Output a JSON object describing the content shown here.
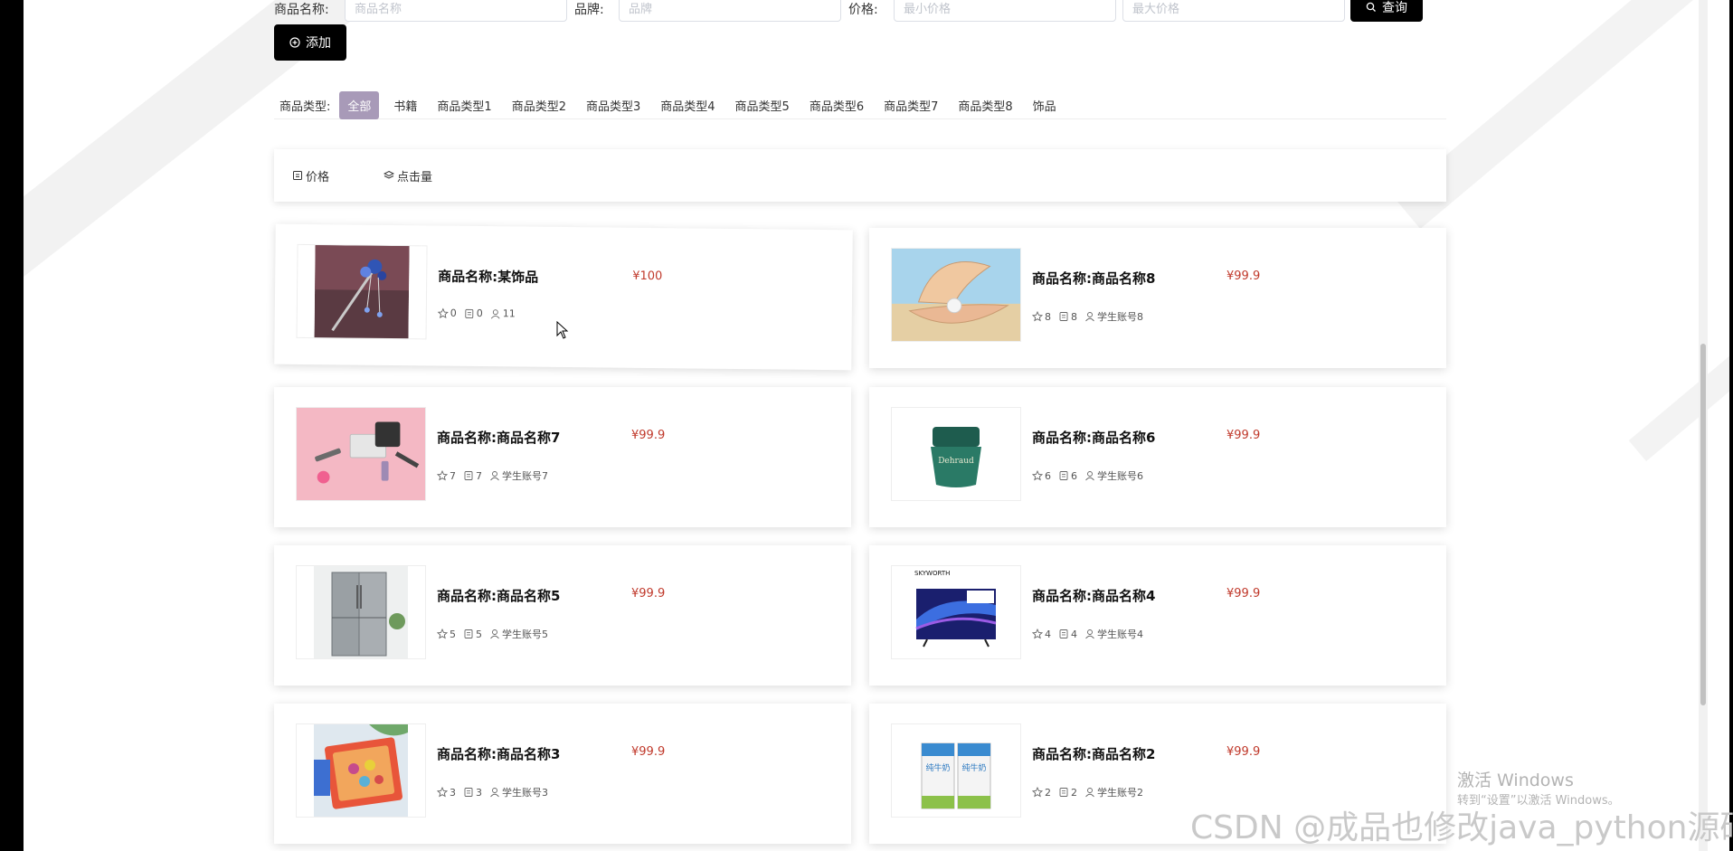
{
  "search": {
    "name_label": "商品名称:",
    "name_placeholder": "商品名称",
    "brand_label": "品牌:",
    "brand_placeholder": "品牌",
    "price_label": "价格:",
    "min_price_placeholder": "最小价格",
    "max_price_placeholder": "最大价格",
    "query_button": "查询",
    "add_button": "添加"
  },
  "categories": {
    "label": "商品类型:",
    "items": [
      "全部",
      "书籍",
      "商品类型1",
      "商品类型2",
      "商品类型3",
      "商品类型4",
      "商品类型5",
      "商品类型6",
      "商品类型7",
      "商品类型8",
      "饰品"
    ],
    "active_index": 0,
    "active_color": "#a89ab8"
  },
  "sort": {
    "price": "价格",
    "clicks": "点击量"
  },
  "products": [
    {
      "name": "商品名称:某饰品",
      "price": "¥100",
      "likes": "0",
      "comments": "0",
      "user": "11",
      "image": "hairpin"
    },
    {
      "name": "商品名称:商品名称8",
      "price": "¥99.9",
      "likes": "8",
      "comments": "8",
      "user": "学生账号8",
      "image": "pearl-shell"
    },
    {
      "name": "商品名称:商品名称7",
      "price": "¥99.9",
      "likes": "7",
      "comments": "7",
      "user": "学生账号7",
      "image": "cosmetics"
    },
    {
      "name": "商品名称:商品名称6",
      "price": "¥99.9",
      "likes": "6",
      "comments": "6",
      "user": "学生账号6",
      "image": "cream-jar"
    },
    {
      "name": "商品名称:商品名称5",
      "price": "¥99.9",
      "likes": "5",
      "comments": "5",
      "user": "学生账号5",
      "image": "refrigerator"
    },
    {
      "name": "商品名称:商品名称4",
      "price": "¥99.9",
      "likes": "4",
      "comments": "4",
      "user": "学生账号4",
      "image": "television"
    },
    {
      "name": "商品名称:商品名称3",
      "price": "¥99.9",
      "likes": "3",
      "comments": "3",
      "user": "学生账号3",
      "image": "snack-box"
    },
    {
      "name": "商品名称:商品名称2",
      "price": "¥99.9",
      "likes": "2",
      "comments": "2",
      "user": "学生账号2",
      "image": "milk-cartons"
    }
  ],
  "tv_brand": "SKYWORTH",
  "cream_brand": "Dehraud",
  "milk_label": "纯牛奶",
  "watermark": {
    "activate_title": "激活 Windows",
    "activate_sub": "转到“设置”以激活 Windows。",
    "csdn": "CSDN @成品也修改java_python源码"
  },
  "colors": {
    "price": "#c0392b",
    "button": "#000000"
  }
}
